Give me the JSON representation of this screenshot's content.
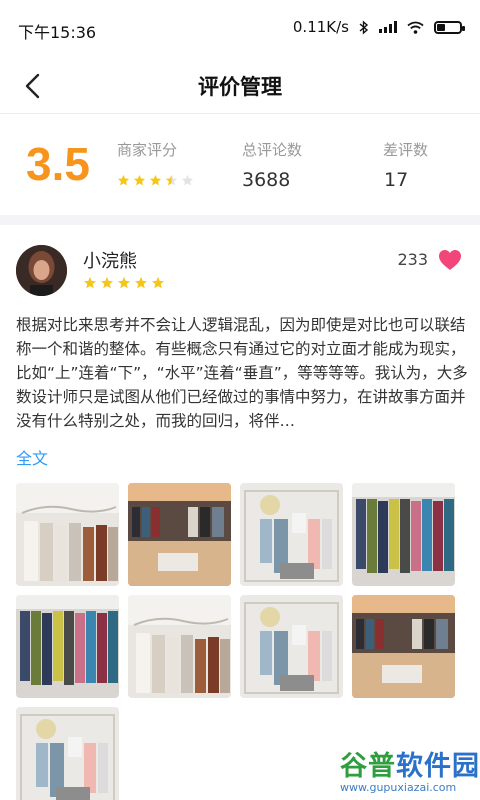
{
  "status_bar": {
    "time": "下午15:36",
    "net_speed": "0.11K/s"
  },
  "nav": {
    "back_icon": "chevron-left-icon",
    "title": "评价管理"
  },
  "summary": {
    "score": "3.5",
    "merchant_rating_label": "商家评分",
    "merchant_rating_stars": 3.5,
    "total_reviews_label": "总评论数",
    "total_reviews_value": "3688",
    "bad_reviews_label": "差评数",
    "bad_reviews_value": "17"
  },
  "review": {
    "user_name": "小浣熊",
    "rating_stars": 5,
    "like_count": "233",
    "text": "根据对比来思考并不会让人逻辑混乱，因为即使是对比也可以联结称一个和谐的整体。有些概念只有通过它的对立面才能成为现实，比如“上”连着“下”，“水平”连着“垂直”，等等等等。我认为，大多数设计师只是试图从他们已经做过的事情中努力，在讲故事方面并没有什么特别之处，而我的回归，将伴…",
    "full_text_link": "全文",
    "photos": [
      "photo-hanger-rail",
      "photo-shop-interior",
      "photo-display-rack",
      "photo-colorful-clothes",
      "photo-colorful-clothes",
      "photo-hanger-rail",
      "photo-display-rack",
      "photo-shop-interior",
      "photo-display-rack"
    ]
  },
  "watermark": {
    "text": "谷普软件园",
    "url": "www.gupuxiazai.com"
  },
  "colors": {
    "accent_orange": "#f7941d",
    "star_yellow": "#f5c518",
    "link_blue": "#2f9bf4",
    "heart_pink": "#f2457a"
  }
}
